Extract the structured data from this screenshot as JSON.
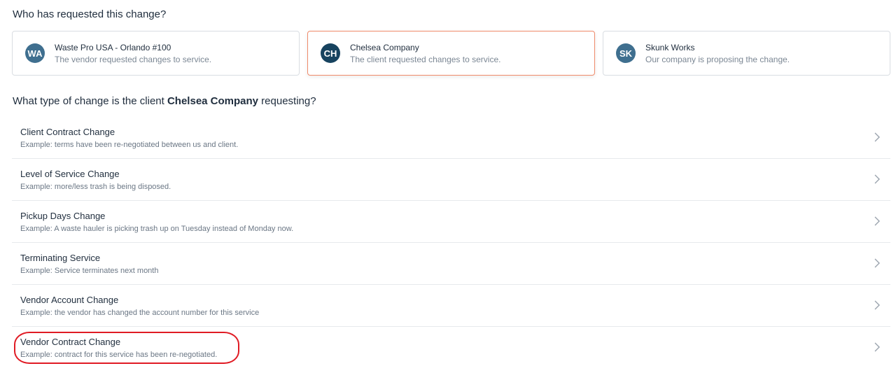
{
  "requester_section": {
    "question": "Who has requested this change?",
    "cards": [
      {
        "initials": "WA",
        "title": "Waste Pro USA - Orlando #100",
        "subtitle": "The vendor requested changes to service.",
        "selected": false
      },
      {
        "initials": "CH",
        "title": "Chelsea Company",
        "subtitle": "The client requested changes to service.",
        "selected": true
      },
      {
        "initials": "SK",
        "title": "Skunk Works",
        "subtitle": "Our company is proposing the change.",
        "selected": false
      }
    ]
  },
  "change_type_section": {
    "question_prefix": "What type of change is the client ",
    "question_company": "Chelsea Company",
    "question_suffix": " requesting?",
    "items": [
      {
        "title": "Client Contract Change",
        "example": "Example: terms have been re-negotiated between us and client."
      },
      {
        "title": "Level of Service Change",
        "example": "Example: more/less trash is being disposed."
      },
      {
        "title": "Pickup Days Change",
        "example": "Example: A waste hauler is picking trash up on Tuesday instead of Monday now."
      },
      {
        "title": "Terminating Service",
        "example": "Example: Service terminates next month"
      },
      {
        "title": "Vendor Account Change",
        "example": "Example: the vendor has changed the account number for this service"
      },
      {
        "title": "Vendor Contract Change",
        "example": "Example: contract for this service has been re-negotiated."
      }
    ]
  },
  "colors": {
    "selected_border": "#ef8a6a",
    "avatar": "#3f6f8f",
    "avatar_selected": "#17435f",
    "annotation": "#e01b24"
  },
  "icons": {
    "row_chevron": "chevron-right-icon"
  }
}
